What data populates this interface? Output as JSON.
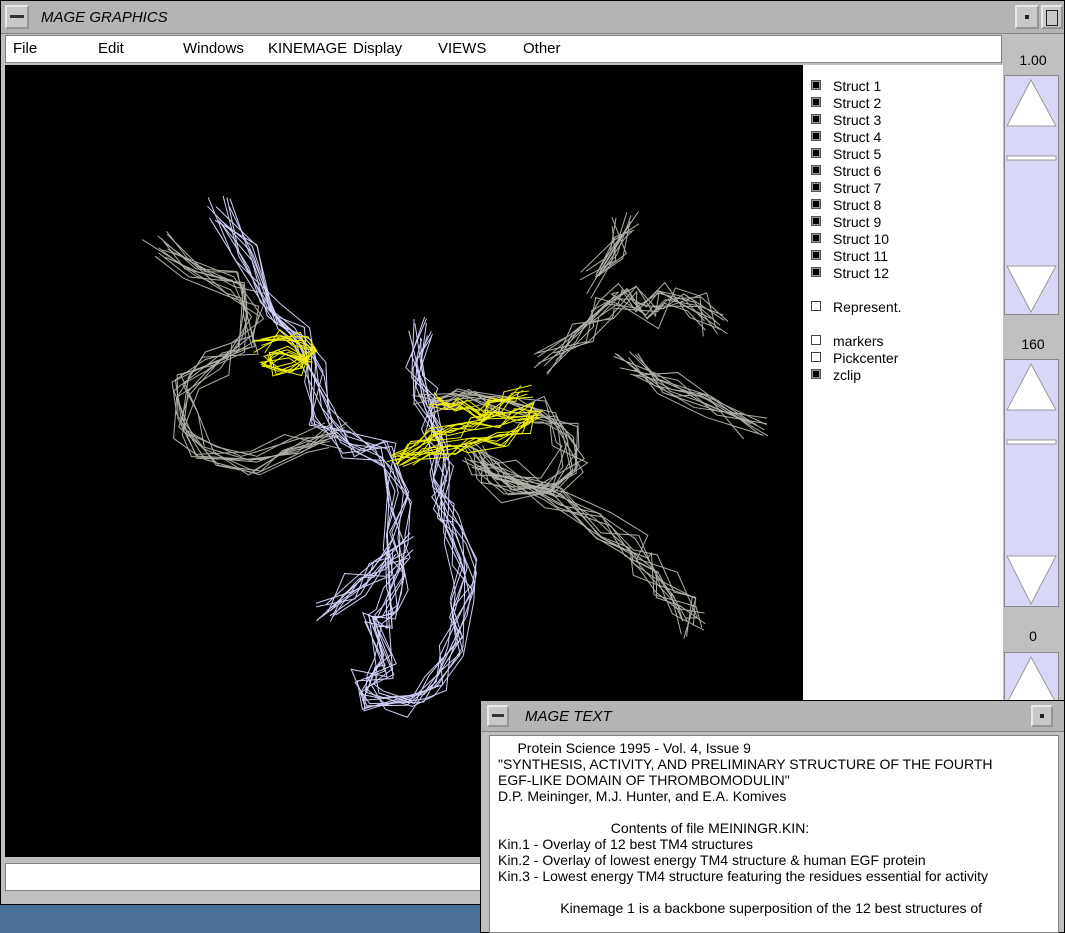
{
  "graphics_window": {
    "title": "MAGE GRAPHICS",
    "menus": [
      "File",
      "Edit",
      "Windows",
      "KINEMAGE",
      "Display",
      "VIEWS",
      "Other"
    ],
    "checkboxes": [
      {
        "label": "Struct 1",
        "checked": true
      },
      {
        "label": "Struct 2",
        "checked": true
      },
      {
        "label": "Struct 3",
        "checked": true
      },
      {
        "label": "Struct 4",
        "checked": true
      },
      {
        "label": "Struct 5",
        "checked": true
      },
      {
        "label": "Struct 6",
        "checked": true
      },
      {
        "label": "Struct 7",
        "checked": true
      },
      {
        "label": "Struct 8",
        "checked": true
      },
      {
        "label": "Struct 9",
        "checked": true
      },
      {
        "label": "Struct 10",
        "checked": true
      },
      {
        "label": "Struct 11",
        "checked": true
      },
      {
        "label": "Struct 12",
        "checked": true
      },
      {
        "label": "Represent.",
        "checked": false
      },
      {
        "label": "markers",
        "checked": false
      },
      {
        "label": "Pickcenter",
        "checked": false
      },
      {
        "label": "zclip",
        "checked": true
      }
    ],
    "sliders": [
      {
        "value": "1.00"
      },
      {
        "value": "160"
      },
      {
        "value": "0"
      }
    ],
    "status_text": ""
  },
  "text_window": {
    "title": "MAGE TEXT",
    "lines": [
      "     Protein Science 1995 - Vol. 4, Issue 9",
      "\"SYNTHESIS, ACTIVITY, AND PRELIMINARY STRUCTURE OF THE FOURTH",
      "EGF-LIKE DOMAIN OF THROMBOMODULIN\"",
      "D.P. Meininger, M.J. Hunter, and E.A. Komives",
      "",
      "                             Contents of file MEININGR.KIN:",
      "Kin.1 - Overlay of 12 best TM4 structures",
      "Kin.2 - Overlay of lowest energy TM4 structure & human EGF protein",
      "Kin.3 - Lowest energy TM4 structure featuring the residues essential for activity",
      "",
      "                Kinemage 1 is a backbone superposition of the 12 best structures of"
    ]
  },
  "colors": {
    "backbone_gray": "#b0b0a8",
    "backbone_lavender": "#d0d0f8",
    "highlight_yellow": "#f0f000",
    "desktop": "#4a6e9a"
  }
}
